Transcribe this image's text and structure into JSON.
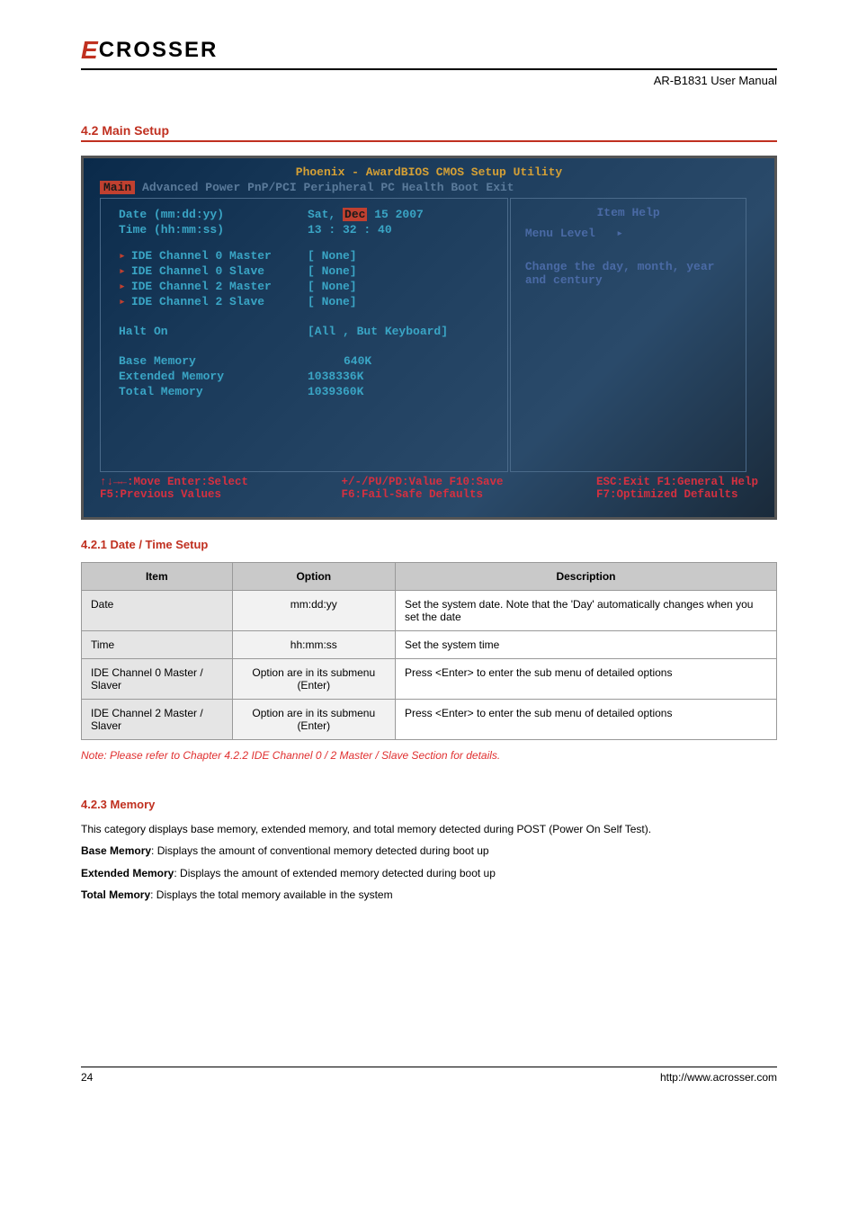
{
  "header": {
    "logo_e": "E",
    "logo_text": "CROSSER",
    "doc_title": "AR-B1831 User Manual"
  },
  "section1": {
    "heading": "4.2 Main Setup",
    "bios": {
      "title": "Phoenix - AwardBIOS CMOS Setup Utility",
      "menu": {
        "active": "Main",
        "items": [
          "Advanced",
          "Power",
          "PnP/PCI",
          "Peripheral",
          "PC Health",
          "Boot",
          "Exit"
        ]
      },
      "rows": {
        "date_label": "Date (mm:dd:yy)",
        "date_value_pre": "Sat, ",
        "date_value_hl": "Dec",
        "date_value_post": " 15 2007",
        "time_label": "Time (hh:mm:ss)",
        "time_value": "13 : 32 : 40",
        "ide0m": "IDE Channel 0 Master",
        "ide0s": "IDE Channel 0 Slave",
        "ide2m": "IDE Channel 2 Master",
        "ide2s": "IDE Channel 2 Slave",
        "none": "[ None]",
        "halt_label": "Halt On",
        "halt_value": "[All , But Keyboard]",
        "base_label": "Base Memory",
        "base_value": "640K",
        "ext_label": "Extended Memory",
        "ext_value": "1038336K",
        "total_label": "Total Memory",
        "total_value": "1039360K"
      },
      "help": {
        "title": "Item Help",
        "level": "Menu Level",
        "level_arrow": "▸",
        "text": "Change the day, month, year and century"
      },
      "footer": {
        "l1": "↑↓→←:Move  Enter:Select",
        "l2": "F5:Previous Values",
        "c1": "+/-/PU/PD:Value  F10:Save",
        "c2": "F6:Fail-Safe Defaults",
        "r1": "ESC:Exit  F1:General Help",
        "r2": "F7:Optimized Defaults"
      }
    },
    "sub_heading": "4.2.1 Date / Time Setup",
    "table": {
      "headers": [
        "Item",
        "Option",
        "Description"
      ],
      "rows": [
        {
          "item": "Date",
          "option": "mm:dd:yy",
          "desc": "Set the system date. Note that the 'Day' automatically changes when you set the date"
        },
        {
          "item": "Time",
          "option": "hh:mm:ss",
          "desc": "Set the system time"
        },
        {
          "item": "IDE Channel 0 Master / Slaver",
          "option": "Option are in its submenu (Enter)",
          "desc": "Press <Enter> to enter the sub menu of detailed options"
        },
        {
          "item": "IDE Channel 2 Master / Slaver",
          "option": "Option are in its submenu (Enter)",
          "desc": "Press <Enter> to enter the sub menu of detailed options"
        }
      ]
    },
    "note": "Note: Please refer to Chapter 4.2.2 IDE Channel 0 / 2 Master / Slave Section for details.",
    "memory": {
      "heading": "4.2.3 Memory",
      "intro": "This category displays base memory, extended memory, and total memory detected during POST (Power On Self Test).",
      "base": "Displays the amount of conventional memory detected during boot up",
      "ext": "Displays the amount of extended memory detected during boot up",
      "total": "Displays the total memory available in the system"
    }
  },
  "footer": {
    "page": "24",
    "suffix": "http://www.acrosser.com"
  }
}
